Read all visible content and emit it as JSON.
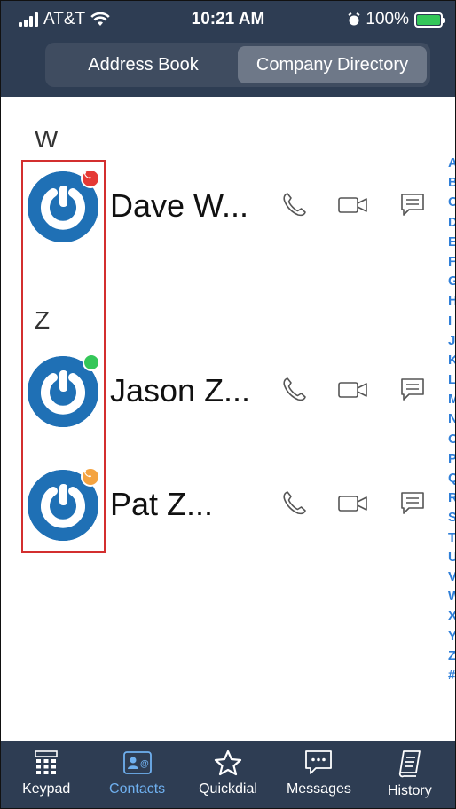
{
  "status_bar": {
    "carrier": "AT&T",
    "time": "10:21 AM",
    "battery": "100%"
  },
  "segments": [
    {
      "label": "Address Book",
      "active": false
    },
    {
      "label": "Company Directory",
      "active": true
    }
  ],
  "sections": {
    "w": "W",
    "z": "Z"
  },
  "contacts": [
    {
      "name": "Dave W...",
      "presence": "busy-call",
      "badge_color": "#e53935"
    },
    {
      "name": "Jason Z...",
      "presence": "available",
      "badge_color": "#34c759"
    },
    {
      "name": "Pat Z...",
      "presence": "away-call",
      "badge_color": "#f4a340"
    }
  ],
  "index_letters": [
    "A",
    "B",
    "C",
    "D",
    "E",
    "F",
    "G",
    "H",
    "I",
    "J",
    "K",
    "L",
    "M",
    "N",
    "O",
    "P",
    "Q",
    "R",
    "S",
    "T",
    "U",
    "V",
    "W",
    "X",
    "Y",
    "Z",
    "#"
  ],
  "tabs": [
    {
      "label": "Keypad",
      "icon": "keypad-icon",
      "active": false
    },
    {
      "label": "Contacts",
      "icon": "contacts-icon",
      "active": true
    },
    {
      "label": "Quickdial",
      "icon": "star-icon",
      "active": false
    },
    {
      "label": "Messages",
      "icon": "messages-icon",
      "active": false
    },
    {
      "label": "History",
      "icon": "history-icon",
      "active": false
    }
  ],
  "colors": {
    "header": "#2e3d53",
    "accent": "#2f7fd8",
    "avatar": "#1f70b5",
    "highlight": "#d32f2f"
  }
}
